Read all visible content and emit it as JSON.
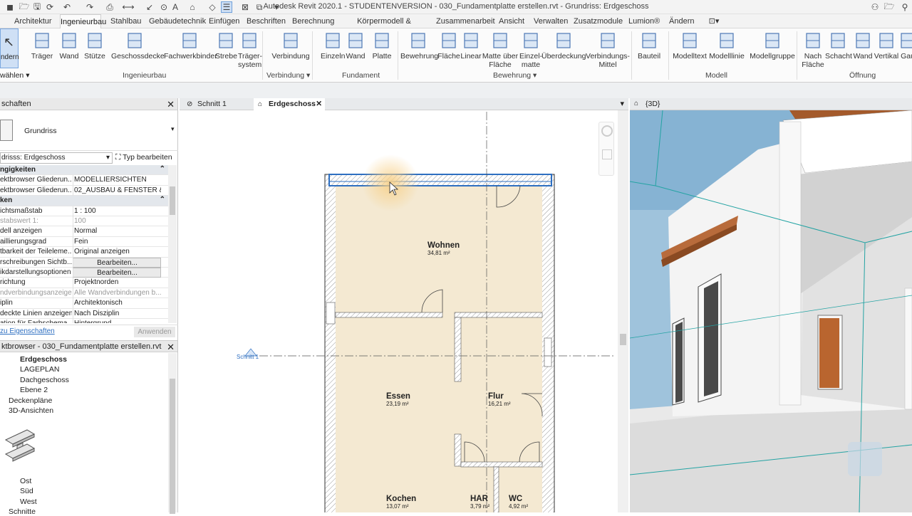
{
  "window": {
    "title": "Autodesk Revit 2020.1 - STUDENTENVERSION - 030_Fundamentplatte erstellen.rvt - Grundriss: Erdgeschoss"
  },
  "tabs": [
    "Architektur",
    "Ingenieurbau",
    "Stahlbau",
    "Gebäudetechnik",
    "Einfügen",
    "Beschriften",
    "Berechnung",
    "Körpermodell & Grundstück",
    "Zusammenarbeit",
    "Ansicht",
    "Verwalten",
    "Zusatzmodule",
    "Lumion®",
    "Ändern"
  ],
  "active_tab": "Ingenieurbau",
  "ribbon": {
    "left_fragment": "ndern",
    "left_fragment2": "wählen ▾",
    "buttons": [
      {
        "label": "Träger"
      },
      {
        "label": "Wand"
      },
      {
        "label": "Stütze"
      },
      {
        "label": "Geschossdecke"
      },
      {
        "label": "Fachwerkbinder"
      },
      {
        "label": "Strebe"
      },
      {
        "label": "Träger-\nsystem"
      },
      {
        "label": "Verbindung"
      },
      {
        "label": "Einzeln"
      },
      {
        "label": "Wand"
      },
      {
        "label": "Platte"
      },
      {
        "label": "Bewehrung"
      },
      {
        "label": "Fläche"
      },
      {
        "label": "Linear"
      },
      {
        "label": "Matte über\nFläche"
      },
      {
        "label": "Einzel-\nmatte"
      },
      {
        "label": "Überdeckung"
      },
      {
        "label": "Verbindungs-\nMittel"
      },
      {
        "label": "Bauteil"
      },
      {
        "label": "Modelltext"
      },
      {
        "label": "Modelllinie"
      },
      {
        "label": "Modellgruppe"
      },
      {
        "label": "Nach\nFläche"
      },
      {
        "label": "Schacht"
      },
      {
        "label": "Wand"
      },
      {
        "label": "Vertikal"
      },
      {
        "label": "Gau"
      }
    ],
    "panels": [
      "Ingenieurbau",
      "Verbindung ▾",
      "Fundament",
      "Bewehrung ▾",
      "Modell",
      "Öffnung"
    ]
  },
  "properties": {
    "header": "schaften",
    "type_name": "Grundriss",
    "filter": "drisss: Erdgeschoss",
    "edit_type": "Typ bearbeiten",
    "rows": [
      {
        "k": "ngigkeiten",
        "v": "",
        "group": true
      },
      {
        "k": "ektbrowser Gliederun...",
        "v": "MODELLIERSICHTEN"
      },
      {
        "k": "ektbrowser Gliederun...",
        "v": "02_AUSBAU & FENSTER & ..."
      },
      {
        "k": "ken",
        "v": "",
        "group": true
      },
      {
        "k": "ichtsmaßstab",
        "v": "1 : 100"
      },
      {
        "k": "stabswert 1:",
        "v": "100",
        "dim": true
      },
      {
        "k": "dell anzeigen",
        "v": "Normal"
      },
      {
        "k": "aillierungsgrad",
        "v": "Fein"
      },
      {
        "k": "tbarkeit der Teileleme...",
        "v": "Original anzeigen"
      },
      {
        "k": "rschreibungen Sichtb...",
        "v": "Bearbeiten...",
        "btn": true
      },
      {
        "k": "ikdarstellungsoptionen",
        "v": "Bearbeiten...",
        "btn": true
      },
      {
        "k": "richtung",
        "v": "Projektnorden"
      },
      {
        "k": "ndverbindungsanzeige",
        "v": "Alle Wandverbindungen b...",
        "dim": true
      },
      {
        "k": "iplin",
        "v": "Architektonisch"
      },
      {
        "k": "deckte Linien anzeigen",
        "v": "Nach Disziplin"
      },
      {
        "k": "ation für Farbschema",
        "v": "Hintergrund"
      }
    ],
    "help_link": "zu Eigenschaften",
    "apply": "Anwenden"
  },
  "browser": {
    "header": "ktbrowser - 030_Fundamentplatte erstellen.rvt",
    "items": [
      {
        "label": "Erdgeschoss",
        "bold": true
      },
      {
        "label": "LAGEPLAN"
      },
      {
        "label": "Dachgeschoss"
      },
      {
        "label": "Ebene 2"
      },
      {
        "label": "Deckenpläne"
      },
      {
        "label": "3D-Ansichten"
      },
      {
        "label": "Ost"
      },
      {
        "label": "Süd"
      },
      {
        "label": "West"
      },
      {
        "label": "Schnitte"
      }
    ]
  },
  "view_tabs": [
    {
      "label": "Schnitt 1"
    },
    {
      "label": "Erdgeschoss",
      "active": true
    }
  ],
  "view3d_tab": "{3D}",
  "plan": {
    "section_label": "Schnitt 1",
    "rooms": [
      {
        "name": "Wohnen",
        "area": "34,81 m²"
      },
      {
        "name": "Essen",
        "area": "23,19 m²"
      },
      {
        "name": "Flur",
        "area": "16,21 m²"
      },
      {
        "name": "Kochen",
        "area": "13,07 m²"
      },
      {
        "name": "HAR",
        "area": "3,79 m²"
      },
      {
        "name": "WC",
        "area": "4,92 m²"
      }
    ]
  },
  "colors": {
    "accent": "#2e6fc1",
    "room_fill": "#f4e9d2",
    "wall_hatch": "#8a8a8a",
    "sky": "#9fc3dc"
  }
}
